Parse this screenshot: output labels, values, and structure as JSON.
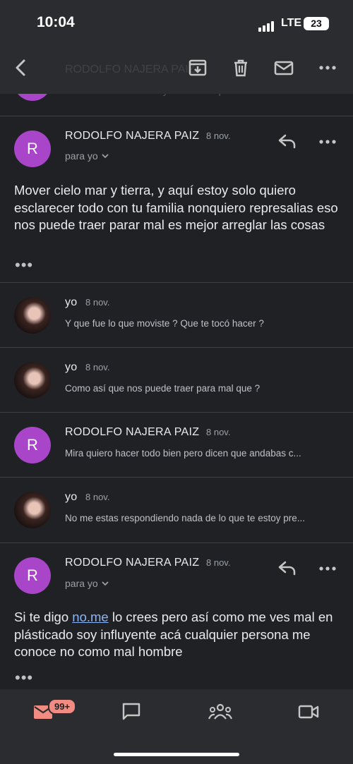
{
  "status": {
    "time": "10:04",
    "network": "LTE",
    "battery": "23"
  },
  "toolbar": {
    "back_icon": "back-arrow-icon",
    "archive_icon": "archive-icon",
    "delete_icon": "trash-icon",
    "mark_unread_icon": "mail-icon",
    "more_icon": "more-horizontal-icon"
  },
  "collapsed_top": {
    "sender": "RODOLFO NAJERA PAIZ",
    "snippet": "Mira de verdad te amo y de verdad quiero formar un h..."
  },
  "messages": [
    {
      "type": "expanded",
      "avatar_letter": "R",
      "sender": "RODOLFO NAJERA PAIZ",
      "date": "8 nov.",
      "to_label": "para yo",
      "body": "Mover cielo mar y tierra, y aquí estoy solo quiero esclarecer todo con tu familia nonquiero represalias eso nos puede traer parar mal es mejor arreglar las cosas"
    },
    {
      "type": "collapsed",
      "sender": "yo",
      "date": "8 nov.",
      "snippet": "Y que fue lo que moviste ? Que te tocó hacer ?"
    },
    {
      "type": "collapsed",
      "sender": "yo",
      "date": "8 nov.",
      "snippet": "Como así que nos puede traer para mal que ?"
    },
    {
      "type": "collapsed",
      "avatar_letter": "R",
      "sender": "RODOLFO NAJERA PAIZ",
      "date": "8 nov.",
      "snippet": "Mira quiero hacer todo bien pero dicen que andabas c..."
    },
    {
      "type": "collapsed",
      "sender": "yo",
      "date": "8 nov.",
      "snippet": "No me estas respondiendo nada de lo que te estoy pre..."
    },
    {
      "type": "expanded",
      "avatar_letter": "R",
      "sender": "RODOLFO NAJERA PAIZ",
      "date": "8 nov.",
      "to_label": "para yo",
      "body_before": "Si te digo ",
      "body_link": "no.me",
      "body_after": " lo crees pero así como me ves mal en plásticado soy influyente acá  cualquier persona me conoce no como mal hombre"
    }
  ],
  "bottom_nav": {
    "mail_badge": "99+",
    "items": [
      "mail-icon",
      "chat-icon",
      "spaces-icon",
      "meet-video-icon"
    ],
    "accent": "#f28b82"
  },
  "colors": {
    "background": "#202124",
    "bar": "#2b2c2f",
    "avatar_purple": "#a845c9",
    "link": "#8ab4f8"
  }
}
